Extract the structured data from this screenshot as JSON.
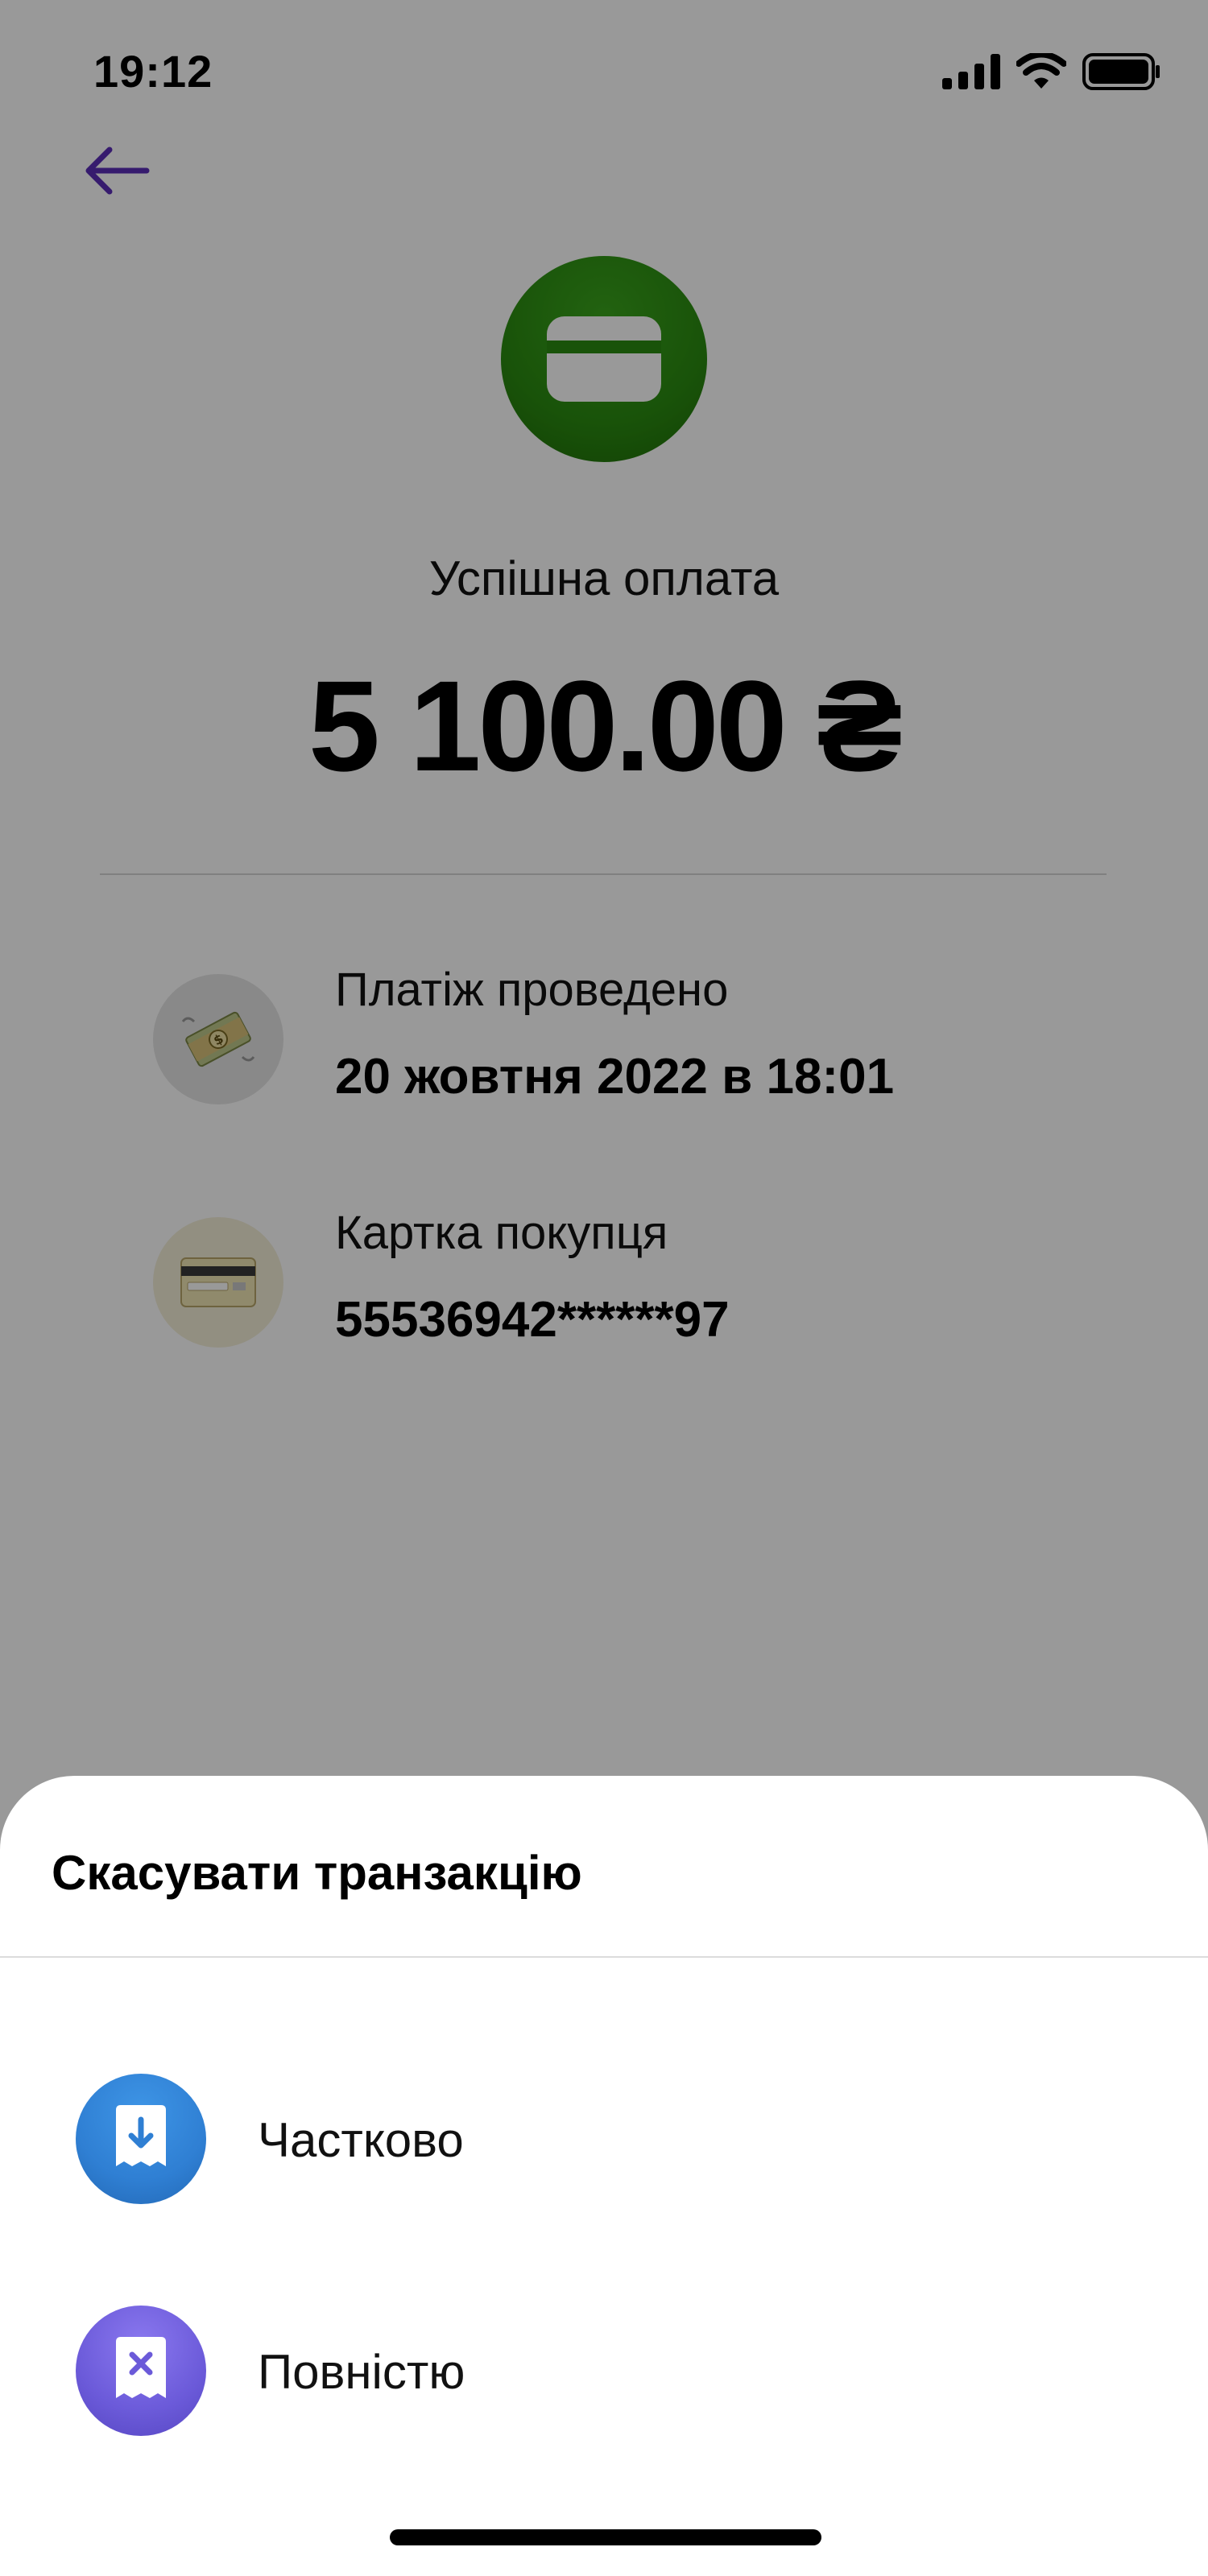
{
  "status_bar": {
    "time": "19:12"
  },
  "payment": {
    "status_title": "Успішна оплата",
    "amount": "5 100.00 ₴"
  },
  "details": [
    {
      "label": "Платіж проведено",
      "value": "20 жовтня 2022 в 18:01",
      "icon": "money-icon"
    },
    {
      "label": "Картка покупця",
      "value": "55536942******97",
      "icon": "credit-card-icon"
    }
  ],
  "sheet": {
    "title": "Скасувати транзакцію",
    "options": [
      {
        "label": "Частково",
        "icon": "receipt-download-icon",
        "color": "#2f7fd3"
      },
      {
        "label": "Повністю",
        "icon": "receipt-cancel-icon",
        "color": "#6b5ad9"
      }
    ]
  },
  "colors": {
    "accent": "#5b2db8",
    "success": "#2a8a10",
    "overlay": "rgba(0,0,0,0.40)"
  }
}
